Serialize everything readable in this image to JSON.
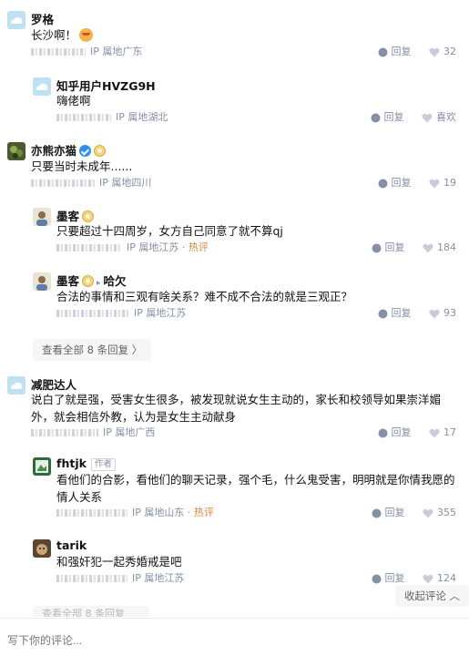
{
  "comments": [
    {
      "user": "罗格",
      "text": "长沙啊！",
      "meta": "IP 属地广东",
      "reply_label": "回复",
      "likes": "32",
      "replies": [
        {
          "user": "知乎用户HVZG9H",
          "text": "嗨佬啊",
          "meta": "IP 属地湖北",
          "reply_label": "回复",
          "likes": "喜欢"
        }
      ]
    },
    {
      "user": "亦熊亦猫",
      "text": "只要当时未成年......",
      "meta": "IP 属地四川",
      "reply_label": "回复",
      "likes": "19",
      "replies": [
        {
          "user": "墨客",
          "text": "只要超过十四周岁，女方自己同意了就不算qj",
          "meta": "IP 属地江苏",
          "hot": "· 热评",
          "reply_label": "回复",
          "likes": "184"
        },
        {
          "user": "墨客",
          "reply_to": "哈欠",
          "text": "合法的事情和三观有啥关系？难不成不合法的就是三观正？",
          "meta": "IP 属地江苏",
          "reply_label": "回复",
          "likes": "93"
        }
      ],
      "view_all": "查看全部 8 条回复 〉"
    },
    {
      "user": "减肥达人",
      "text": "说白了就是强，受害女生很多，被发现就说女生主动的，家长和校领导如果崇洋媚外，就会相信外教，认为是女生主动献身",
      "meta": "IP 属地广西",
      "reply_label": "回复",
      "likes": "17",
      "replies": [
        {
          "user": "fhtjk",
          "tag": "作者",
          "text": "看他们的合影，看他们的聊天记录，强个毛，什么鬼受害，明明就是你情我愿的情人关系",
          "meta": "IP 属地山东",
          "hot": "· 热评",
          "reply_label": "回复",
          "likes": "355"
        },
        {
          "user": "tarik",
          "text": "和强奸犯一起秀婚戒是吧",
          "meta": "IP 属地江苏",
          "reply_label": "回复",
          "likes": "124"
        }
      ]
    }
  ],
  "collapse_label": "收起评论 ︿",
  "comment_input": {
    "placeholder": "写下你的评论..."
  },
  "cutoff_text": "查看全部 8 条回复",
  "colors": {
    "meta": "#8590a6",
    "hot": "#d48a3c",
    "divider": "#ebebeb"
  }
}
